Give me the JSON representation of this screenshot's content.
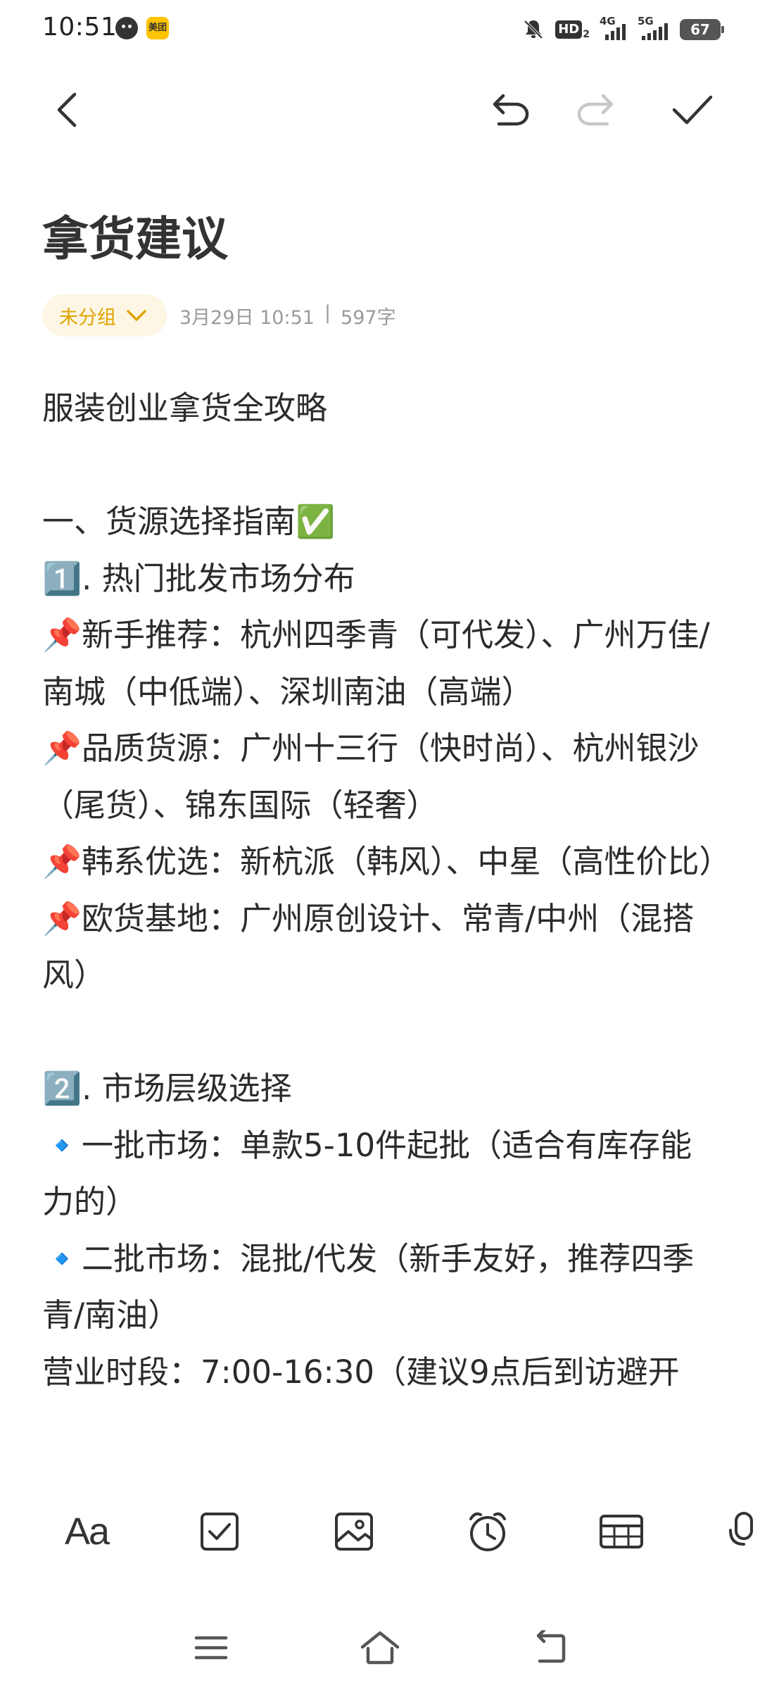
{
  "status_bar": {
    "time": "10:51",
    "meituan_badge": "美团",
    "hd_badge": "HD",
    "network_1": "4G",
    "network_2": "5G",
    "battery": "67"
  },
  "note": {
    "title": "拿货建议",
    "group_label": "未分组",
    "date": "3月29日 10:51",
    "separator": "|",
    "word_count": "597字",
    "lines": [
      "服装创业拿货全攻略",
      "",
      "一、货源选择指南✅",
      "1️⃣. 热门批发市场分布",
      "📌新手推荐：杭州四季青（可代发）、广州万佳/南城（中低端）、深圳南油（高端）",
      "📌品质货源：广州十三行（快时尚）、杭州银沙（尾货）、锦东国际（轻奢）",
      "📌韩系优选：新杭派（韩风）、中星（高性价比）",
      "📌欧货基地：广州原创设计、常青/中州（混搭风）",
      "",
      "2️⃣. 市场层级选择",
      "🔹一批市场：单款5-10件起批（适合有库存能力的）",
      "🔹二批市场：混批/代发（新手友好，推荐四季青/南油）",
      "营业时段：7:00-16:30（建议9点后到访避开"
    ]
  },
  "edit_bar": {
    "format_label": "Aa",
    "icons": [
      "format-icon",
      "checklist-icon",
      "image-icon",
      "reminder-icon",
      "table-icon",
      "voice-icon"
    ]
  },
  "system_nav": {
    "icons": [
      "menu-icon",
      "home-icon",
      "back-icon"
    ]
  },
  "colors": {
    "accent": "#e0a400",
    "chip_background": "#fdf6e4",
    "text": "#2b2b2b",
    "meta_text": "#9a9a9a",
    "disabled_icon": "#c8c8c8"
  }
}
